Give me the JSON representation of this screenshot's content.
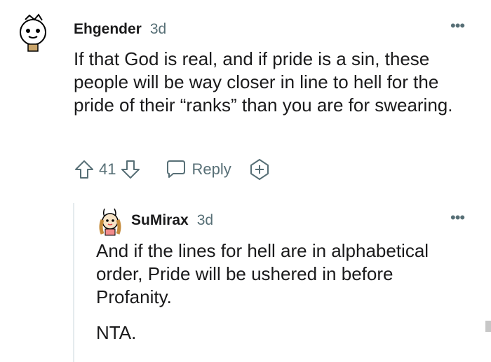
{
  "comment": {
    "author": "Ehgender",
    "age": "3d",
    "text": "If that God is real, and if pride is a sin, these people will be way closer in line to hell for the pride of their “ranks” than you are for swearing.",
    "score": "41",
    "reply_label": "Reply",
    "avatar_icon": "snoo-avatar-icon",
    "more_icon": "more-options-icon"
  },
  "reply": {
    "author": "SuMirax",
    "age": "3d",
    "text_p1": "And if the lines for hell are in alphabetical order, Pride will be ushered in before Profanity.",
    "text_p2": "NTA.",
    "avatar_icon": "bunny-avatar-icon",
    "more_icon": "more-options-icon"
  },
  "colors": {
    "text": "#1a1a1b",
    "muted": "#576f76",
    "thread_line": "#e5ebee"
  }
}
